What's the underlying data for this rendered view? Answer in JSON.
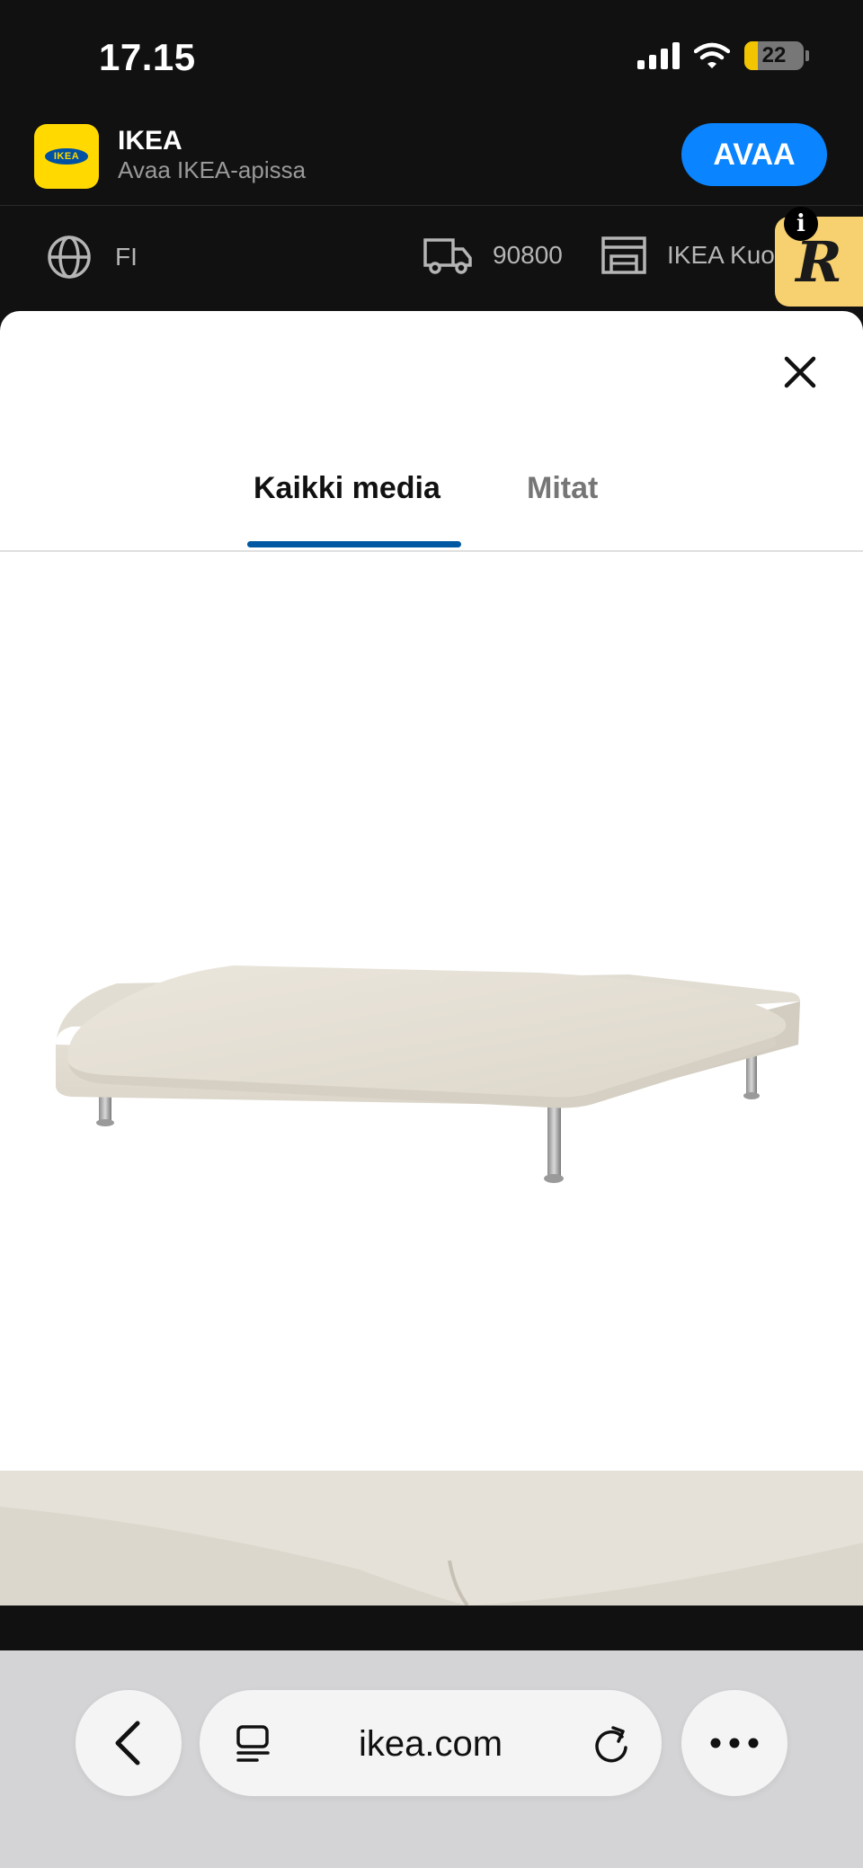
{
  "status_bar": {
    "time": "17.15",
    "battery": "22"
  },
  "app_banner": {
    "name": "IKEA",
    "subtitle": "Avaa IKEA-apissa",
    "open_label": "AVAA",
    "logo_text": "IKEA"
  },
  "site_header": {
    "language": "FI",
    "postal_code": "90800",
    "store": "IKEA Kuo",
    "extension_letter": "R",
    "info_letter": "i"
  },
  "media_sheet": {
    "tabs": [
      {
        "label": "Kaikki media",
        "active": true
      },
      {
        "label": "Mitat",
        "active": false
      }
    ]
  },
  "browser": {
    "url": "ikea.com"
  },
  "colors": {
    "accent_blue": "#0058a3",
    "open_button": "#0a84ff",
    "badge_yellow": "#f7d070"
  }
}
